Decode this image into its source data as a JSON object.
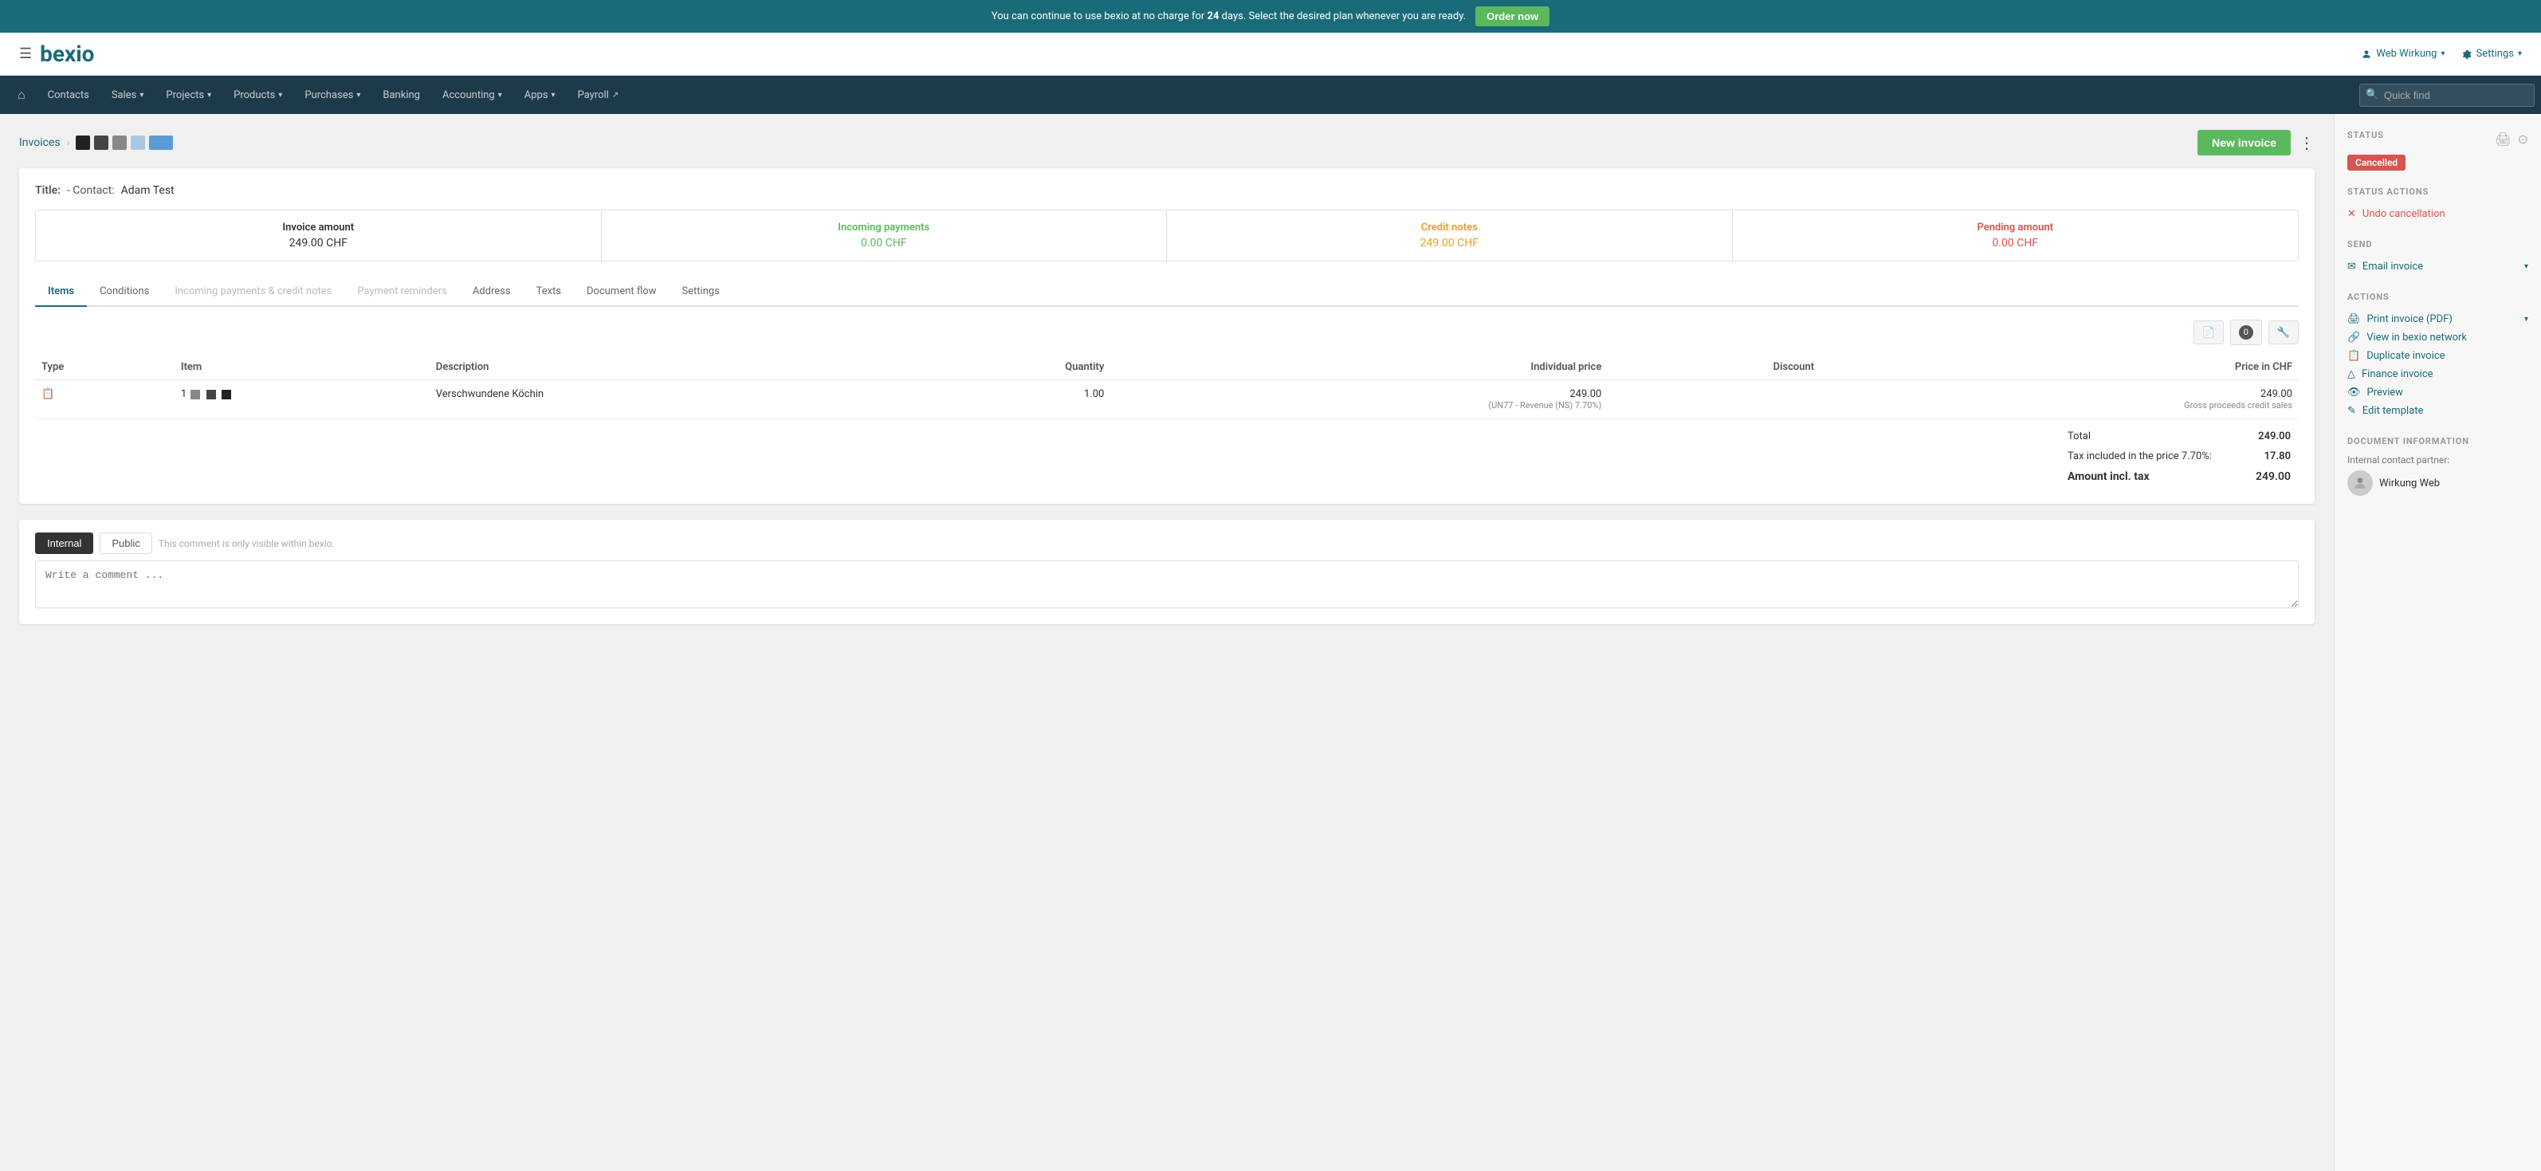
{
  "banner": {
    "text_before": "You can continue to use bexio at no charge for ",
    "days": "24",
    "text_after": " days. Select the desired plan whenever you are ready.",
    "order_btn": "Order now"
  },
  "header": {
    "logo": "bexio",
    "user_label": "Web Wirkung",
    "settings_label": "Settings"
  },
  "nav": {
    "home_icon": "⌂",
    "items": [
      {
        "label": "Contacts",
        "has_dropdown": false
      },
      {
        "label": "Sales",
        "has_dropdown": true
      },
      {
        "label": "Projects",
        "has_dropdown": true
      },
      {
        "label": "Products",
        "has_dropdown": true
      },
      {
        "label": "Purchases",
        "has_dropdown": true
      },
      {
        "label": "Banking",
        "has_dropdown": false
      },
      {
        "label": "Accounting",
        "has_dropdown": true
      },
      {
        "label": "Apps",
        "has_dropdown": true
      },
      {
        "label": "Payroll",
        "has_dropdown": false,
        "external": true
      }
    ],
    "search_placeholder": "Quick find"
  },
  "breadcrumb": {
    "invoices_link": "Invoices",
    "new_invoice_btn": "New invoice"
  },
  "invoice": {
    "title_label": "Title:",
    "contact_label": "- Contact:",
    "contact_value": "Adam Test",
    "summary": {
      "invoice_amount_label": "Invoice amount",
      "invoice_amount_value": "249.00 CHF",
      "incoming_payments_label": "Incoming payments",
      "incoming_payments_value": "0.00 CHF",
      "credit_notes_label": "Credit notes",
      "credit_notes_value": "249.00 CHF",
      "pending_amount_label": "Pending amount",
      "pending_amount_value": "0.00 CHF"
    },
    "tabs": [
      {
        "label": "Items",
        "active": true
      },
      {
        "label": "Conditions",
        "active": false
      },
      {
        "label": "Incoming payments & credit notes",
        "active": false,
        "disabled": true
      },
      {
        "label": "Payment reminders",
        "active": false,
        "disabled": true
      },
      {
        "label": "Address",
        "active": false
      },
      {
        "label": "Texts",
        "active": false
      },
      {
        "label": "Document flow",
        "active": false
      },
      {
        "label": "Settings",
        "active": false
      }
    ],
    "table": {
      "columns": [
        "Type",
        "Item",
        "Description",
        "Quantity",
        "Individual price",
        "Discount",
        "Price in CHF"
      ],
      "rows": [
        {
          "type_icon": "📋",
          "item_number": "1",
          "description": "Verschwundene Köchin",
          "quantity": "1.00",
          "individual_price": "249.00",
          "price_note": "(UN77 - Revenue (NS) 7.70%)",
          "discount": "",
          "price_in_chf": "249.00",
          "price_note2": "Gross proceeds credit sales"
        }
      ]
    },
    "totals": {
      "total_label": "Total",
      "total_value": "249.00",
      "tax_label": "Tax included in the price 7.70%:",
      "tax_value": "17.80",
      "amount_incl_label": "Amount incl. tax",
      "amount_incl_value": "249.00"
    }
  },
  "comments": {
    "internal_tab": "Internal",
    "public_tab": "Public",
    "hint": "This comment is only visible within bexio.",
    "placeholder": "Write a comment ..."
  },
  "sidebar": {
    "status_section_title": "STATUS",
    "status_badge": "Cancelled",
    "status_actions_title": "STATUS ACTIONS",
    "undo_cancellation": "Undo cancellation",
    "send_title": "SEND",
    "email_invoice": "Email invoice",
    "actions_title": "ACTIONS",
    "actions": [
      {
        "label": "Print invoice (PDF)",
        "has_dropdown": true
      },
      {
        "label": "View in bexio network",
        "has_dropdown": false
      },
      {
        "label": "Duplicate invoice",
        "has_dropdown": false
      },
      {
        "label": "Finance invoice",
        "has_dropdown": false
      },
      {
        "label": "Preview",
        "has_dropdown": false
      },
      {
        "label": "Edit template",
        "has_dropdown": false
      }
    ],
    "doc_info_title": "DOCUMENT INFORMATION",
    "internal_contact_label": "Internal contact partner:",
    "contact_name": "Wirkung Web"
  }
}
